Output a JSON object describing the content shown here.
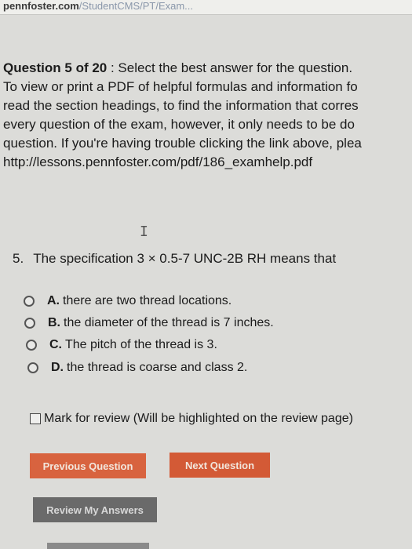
{
  "browser": {
    "url_host": "pennfoster.com",
    "url_path": "/StudentCMS/PT/Exam..."
  },
  "intro": {
    "question_label": "Question 5 of 20",
    "line1_rest": " : Select the best answer for the question.",
    "line2": "To view or print a PDF of helpful formulas and information fo",
    "line3": "read the section headings, to find the information that corres",
    "line4": "every question of the exam, however, it only needs to be do",
    "line5": "question. If you're having trouble clicking the link above, plea",
    "line6": "http://lessons.pennfoster.com/pdf/186_examhelp.pdf"
  },
  "question": {
    "number": "5.",
    "text": "The specification 3 × 0.5-7 UNC-2B RH means that"
  },
  "options": [
    {
      "letter": "A.",
      "text": "there are two thread locations."
    },
    {
      "letter": "B.",
      "text": "the diameter of the thread is 7 inches."
    },
    {
      "letter": "C.",
      "text": "The pitch of the thread is 3."
    },
    {
      "letter": "D.",
      "text": "the thread is coarse and class 2."
    }
  ],
  "review": {
    "label": "Mark for review (Will be highlighted on the review page)",
    "checked": false
  },
  "buttons": {
    "previous": "Previous Question",
    "next": "Next Question",
    "review_answers": "Review My Answers"
  },
  "colors": {
    "accent": "#d35a36",
    "secondary_button": "#6a6a6a",
    "background": "#dcdcd9"
  }
}
